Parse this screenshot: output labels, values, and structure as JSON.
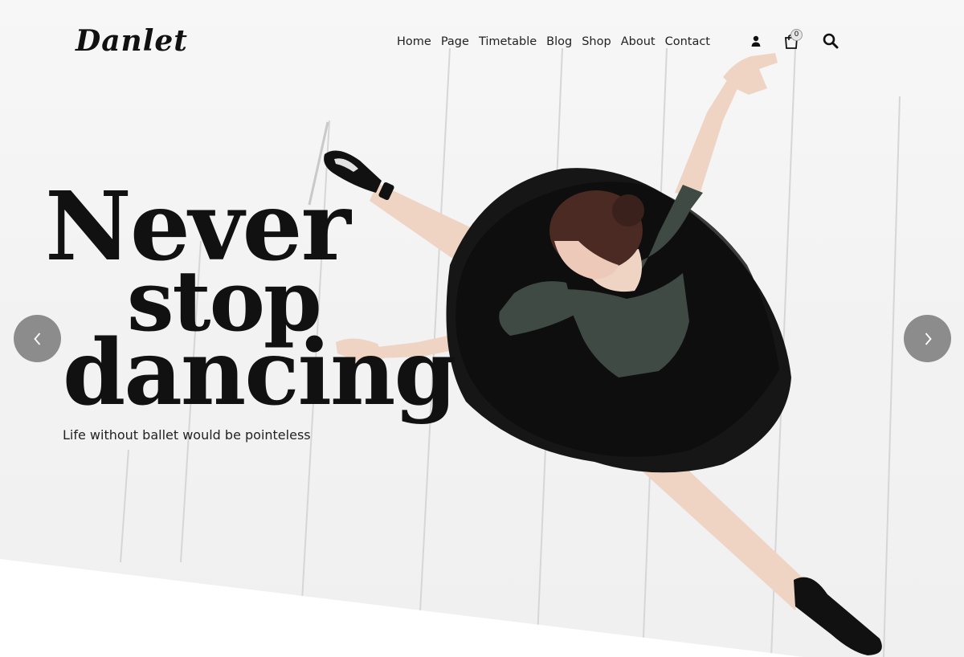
{
  "brand": {
    "logo_text": "Danlet"
  },
  "nav": {
    "items": [
      {
        "label": "Home"
      },
      {
        "label": "Page"
      },
      {
        "label": "Timetable"
      },
      {
        "label": "Blog"
      },
      {
        "label": "Shop"
      },
      {
        "label": "About"
      },
      {
        "label": "Contact"
      }
    ]
  },
  "header_icons": {
    "user": "user-icon",
    "cart": "cart-icon",
    "cart_count": "0",
    "search": "search-icon"
  },
  "hero": {
    "headline": [
      "Never",
      "stop",
      "dancing"
    ],
    "tagline": "Life without ballet would be pointeless",
    "prev_icon": "chevron-left-icon",
    "next_icon": "chevron-right-icon"
  },
  "colors": {
    "background": "#f3f3f3",
    "text": "#111111",
    "arrow_bg": "#8c8c8c",
    "leotard": "#3f4a44",
    "tutu": "#141414"
  }
}
